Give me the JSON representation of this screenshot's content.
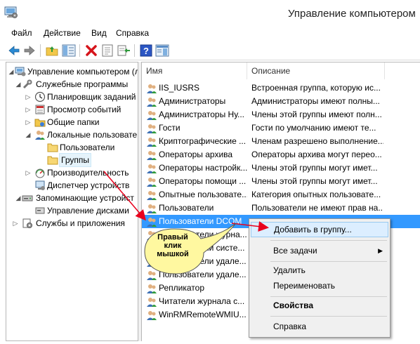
{
  "window": {
    "title": "Управление компьютером"
  },
  "menu": [
    "Файл",
    "Действие",
    "Вид",
    "Справка"
  ],
  "toolbar": {
    "buttons": [
      "back-icon",
      "forward-icon",
      "up-folder-icon",
      "show-hide-tree-icon",
      "delete-icon",
      "properties-icon",
      "export-icon",
      "help-icon",
      "console-icon"
    ]
  },
  "tree": [
    {
      "label": "Управление компьютером (л",
      "icon": "computer-management-icon",
      "expanded": true
    },
    {
      "label": "Служебные программы",
      "icon": "tools-icon",
      "expanded": true
    },
    {
      "label": "Планировщик заданий",
      "icon": "clock-icon",
      "expanded": false
    },
    {
      "label": "Просмотр событий",
      "icon": "event-viewer-icon",
      "expanded": false
    },
    {
      "label": "Общие папки",
      "icon": "shared-folders-icon",
      "expanded": false
    },
    {
      "label": "Локальные пользовате",
      "icon": "users-icon",
      "expanded": true
    },
    {
      "label": "Пользователи",
      "icon": "folder-icon"
    },
    {
      "label": "Группы",
      "icon": "folder-icon",
      "selected": true
    },
    {
      "label": "Производительность",
      "icon": "performance-icon",
      "expanded": false
    },
    {
      "label": "Диспетчер устройств",
      "icon": "device-manager-icon"
    },
    {
      "label": "Запоминающие устройст",
      "icon": "storage-icon",
      "expanded": true
    },
    {
      "label": "Управление дисками",
      "icon": "disk-icon"
    },
    {
      "label": "Службы и приложения",
      "icon": "services-icon",
      "expanded": false
    }
  ],
  "list": {
    "columns": [
      "Имя",
      "Описание"
    ],
    "rows": [
      {
        "name": "IIS_IUSRS",
        "desc": "Встроенная группа, которую ис..."
      },
      {
        "name": "Администраторы",
        "desc": "Администраторы имеют полны..."
      },
      {
        "name": "Администраторы Ну...",
        "desc": "Члены этой группы имеют полн..."
      },
      {
        "name": "Гости",
        "desc": "Гости по умолчанию имеют те..."
      },
      {
        "name": "Криптографические ...",
        "desc": "Членам разрешено выполнение..."
      },
      {
        "name": "Операторы архива",
        "desc": "Операторы архива могут перео..."
      },
      {
        "name": "Операторы настройк...",
        "desc": "Члены этой группы могут имет..."
      },
      {
        "name": "Операторы помощи ...",
        "desc": "Члены этой группы могут имет..."
      },
      {
        "name": "Опытные пользовате...",
        "desc": "Категория опытных пользовате..."
      },
      {
        "name": "Пользователи",
        "desc": "Пользователи не имеют прав на..."
      },
      {
        "name": "Пользователи DCOM",
        "desc": "",
        "selected": true
      },
      {
        "name": "Пользователи журна...",
        "desc": ""
      },
      {
        "name": "Пользователи систе...",
        "desc": ""
      },
      {
        "name": "Пользователи удале...",
        "desc": ""
      },
      {
        "name": "Пользователи удале...",
        "desc": ""
      },
      {
        "name": "Репликатор",
        "desc": ""
      },
      {
        "name": "Читатели журнала с...",
        "desc": ""
      },
      {
        "name": "WinRMRemoteWMIU...",
        "desc": ""
      }
    ]
  },
  "context_menu": {
    "add_to_group": "Добавить в группу...",
    "all_tasks": "Все задачи",
    "delete": "Удалить",
    "rename": "Переименовать",
    "properties": "Свойства",
    "help": "Справка"
  },
  "annotation": {
    "callout_text": "Правый клик мышкой",
    "arrow_color": "#e8001c",
    "callout_fill": "#fff8a0"
  }
}
